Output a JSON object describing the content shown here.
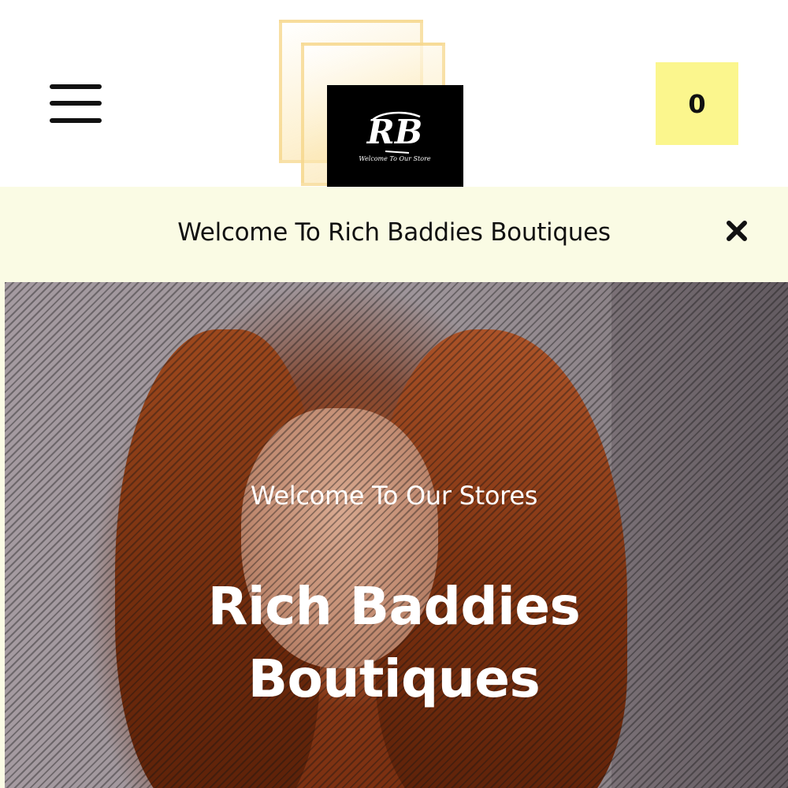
{
  "header": {
    "logo": {
      "monogram": "RB",
      "tagline": "Welcome To Our Store"
    },
    "cart_count": "0",
    "colors": {
      "cart_background": "#fbf68d",
      "logo_background": "#000000"
    },
    "icons": {
      "menu": "hamburger-menu-icon"
    }
  },
  "announcement": {
    "text": "Welcome To Rich Baddies Boutiques",
    "close_icon": "close-icon",
    "background": "#fafbe4"
  },
  "hero": {
    "subtitle": "Welcome To Our Stores",
    "title_line1": "Rich Baddies",
    "title_line2": "Boutiques"
  }
}
